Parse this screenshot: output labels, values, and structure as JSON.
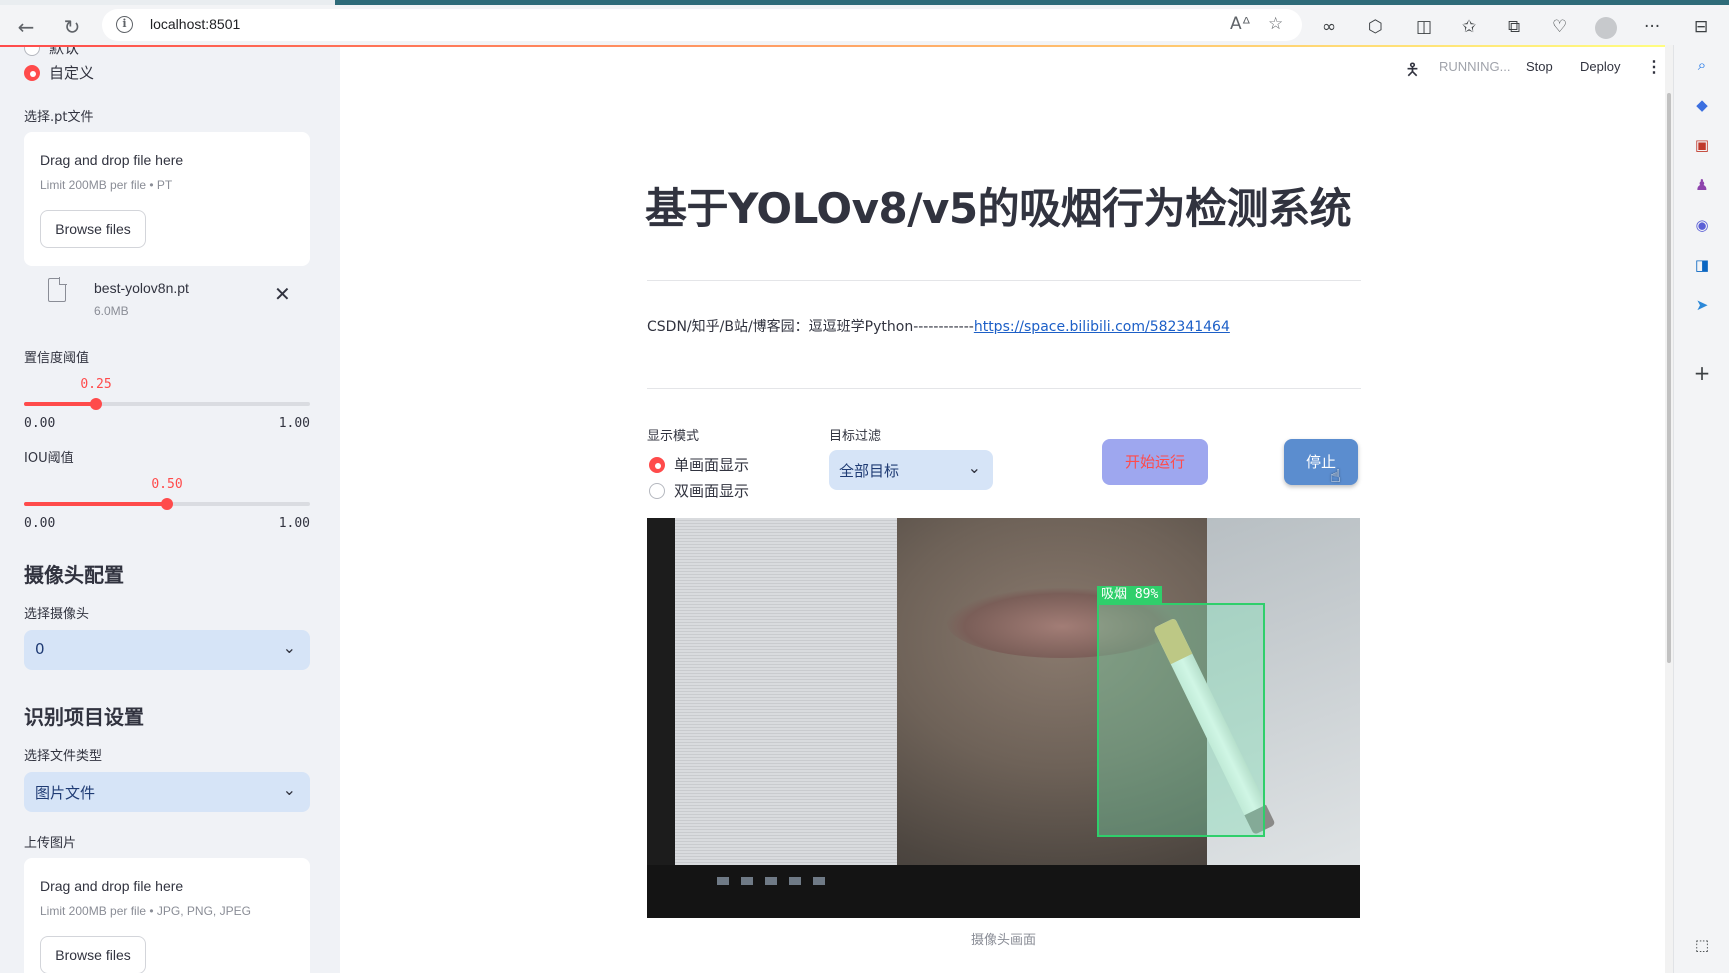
{
  "browser": {
    "url": "localhost:8501",
    "accent": "#2e6b79"
  },
  "app_toolbar": {
    "status": "RUNNING...",
    "stop": "Stop",
    "deploy": "Deploy"
  },
  "sidebar": {
    "model_radio": {
      "options": [
        "默认",
        "自定义"
      ],
      "selected": "自定义"
    },
    "pt_uploader": {
      "label": "选择.pt文件",
      "drag_text": "Drag and drop file here",
      "limit_text": "Limit 200MB per file • PT",
      "browse_label": "Browse files",
      "uploaded_file": {
        "name": "best-yolov8n.pt",
        "size": "6.0MB"
      }
    },
    "confidence": {
      "label": "置信度阈值",
      "value": "0.25",
      "fraction": 0.25,
      "min": "0.00",
      "max": "1.00"
    },
    "iou": {
      "label": "IOU阈值",
      "value": "0.50",
      "fraction": 0.5,
      "min": "0.00",
      "max": "1.00"
    },
    "camera_section": {
      "heading": "摄像头配置",
      "select_label": "选择摄像头",
      "select_value": "0"
    },
    "recognition_section": {
      "heading": "识别项目设置",
      "filetype_label": "选择文件类型",
      "filetype_value": "图片文件",
      "upload_label": "上传图片"
    },
    "image_uploader": {
      "drag_text": "Drag and drop file here",
      "limit_text": "Limit 200MB per file • JPG, PNG, JPEG",
      "browse_label": "Browse files"
    }
  },
  "main": {
    "title": "基于YOLOv8/v5的吸烟行为检测系统",
    "credit_text": "CSDN/知乎/B站/博客园：逗逗班学Python------------",
    "credit_link": "https://space.bilibili.com/582341464",
    "display_mode": {
      "label": "显示模式",
      "options": [
        "单画面显示",
        "双画面显示"
      ],
      "selected": "单画面显示"
    },
    "target_filter": {
      "label": "目标过滤",
      "value": "全部目标"
    },
    "start_button": "开始运行",
    "stop_button": "停止",
    "detection_label": "吸烟 89%",
    "caption": "摄像头画面"
  },
  "colors": {
    "primary": "#ff4b4b",
    "select_bg": "#d6e4f7",
    "detection_box": "#2fcf6b"
  }
}
